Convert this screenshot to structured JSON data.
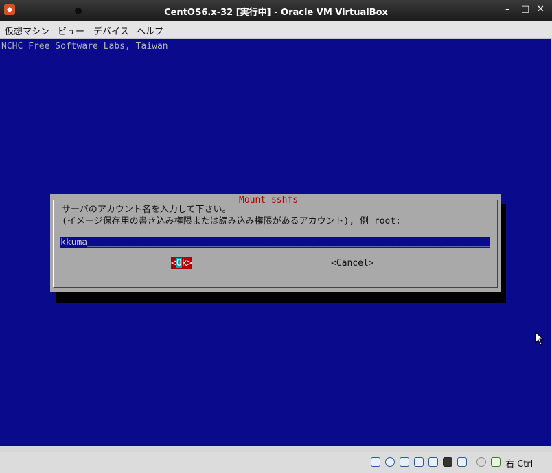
{
  "window": {
    "title": "CentOS6.x-32 [実行中] - Oracle VM VirtualBox",
    "minimize_glyph": "–",
    "maximize_glyph": "□",
    "close_glyph": "✕"
  },
  "menubar": {
    "items": [
      "仮想マシン",
      "ビュー",
      "デバイス",
      "ヘルプ"
    ]
  },
  "console": {
    "backtitle": "NCHC Free Software Labs, Taiwan",
    "dialog": {
      "title": "Mount sshfs",
      "prompt_line1": "サーバのアカウント名を入力して下さい。",
      "prompt_line2": "(イメージ保存用の書き込み権限または読み込み権限があるアカウント), 例 root:",
      "input_value": "kkuma",
      "ok_label_pre": "<",
      "ok_label_hot": "O",
      "ok_label_post": "k>",
      "cancel_label": "<Cancel>"
    }
  },
  "statusbar": {
    "icons": [
      "hard-disk-icon",
      "optical-drive-icon",
      "usb-icon",
      "shared-folders-icon",
      "display-icon",
      "network-icon",
      "video-capture-icon",
      "mouse-integration-icon",
      "arrow-down-icon"
    ],
    "host_key": "右 Ctrl"
  }
}
